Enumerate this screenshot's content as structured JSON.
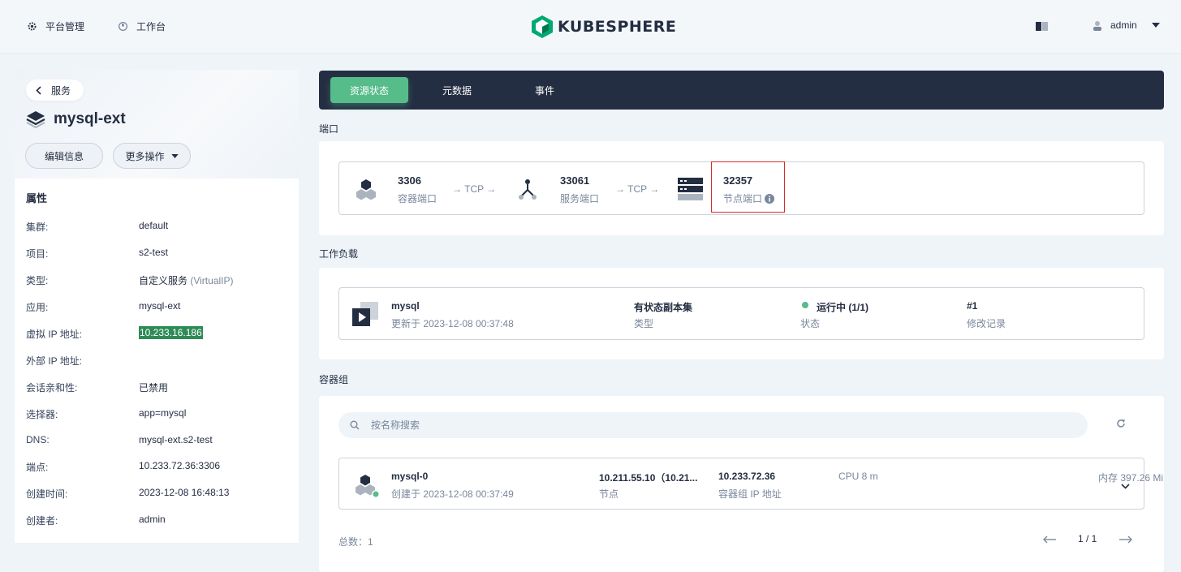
{
  "topbar": {
    "platform_label": "平台管理",
    "workbench_label": "工作台",
    "logo_text": "KUBESPHERE",
    "user_name": "admin"
  },
  "left": {
    "back_label": "服务",
    "resource_name": "mysql-ext",
    "edit_label": "编辑信息",
    "more_label": "更多操作",
    "props_title": "属性",
    "props": [
      {
        "key": "集群:",
        "value": "default"
      },
      {
        "key": "项目:",
        "value": "s2-test"
      },
      {
        "key": "类型:",
        "value": "自定义服务",
        "extra": "(VirtualIP)"
      },
      {
        "key": "应用:",
        "value": "mysql-ext"
      },
      {
        "key": "虚拟 IP 地址:",
        "value": "10.233.16.186"
      },
      {
        "key": "外部 IP 地址:",
        "value": ""
      },
      {
        "key": "会话亲和性:",
        "value": "已禁用"
      },
      {
        "key": "选择器:",
        "value": "app=mysql"
      },
      {
        "key": "DNS:",
        "value": "mysql-ext.s2-test"
      },
      {
        "key": "端点:",
        "value": "10.233.72.36:3306"
      },
      {
        "key": "创建时间:",
        "value": "2023-12-08 16:48:13"
      },
      {
        "key": "创建者:",
        "value": "admin"
      }
    ]
  },
  "tabs": [
    "资源状态",
    "元数据",
    "事件"
  ],
  "ports": {
    "section_label": "端口",
    "container_port": "3306",
    "container_port_label": "容器端口",
    "arrow1": "→ TCP →",
    "service_port": "33061",
    "service_port_label": "服务端口",
    "arrow2": "→ TCP →",
    "node_port": "32357",
    "node_port_label": "节点端口"
  },
  "workload": {
    "section_label": "工作负载",
    "name": "mysql",
    "updated": "更新于 2023-12-08 00:37:48",
    "kind": "有状态副本集",
    "kind_label": "类型",
    "status": "运行中 (1/1)",
    "status_label": "状态",
    "revision": "#1",
    "revision_label": "修改记录"
  },
  "pods": {
    "section_label": "容器组",
    "search_placeholder": "按名称搜索",
    "pod_name": "mysql-0",
    "created": "创建于 2023-12-08 00:37:49",
    "node": "10.211.55.10（10.21...",
    "node_label": "节点",
    "pod_ip": "10.233.72.36",
    "pod_ip_label": "容器组 IP 地址",
    "cpu": "CPU 8 m",
    "memory": "内存 397.26 Mi",
    "total": "总数：1",
    "page": "1 / 1"
  },
  "colors": {
    "accent": "#55bc8a",
    "dark": "#242e42",
    "highlight": "#2e8b57",
    "red_box": "#d62c2c"
  }
}
